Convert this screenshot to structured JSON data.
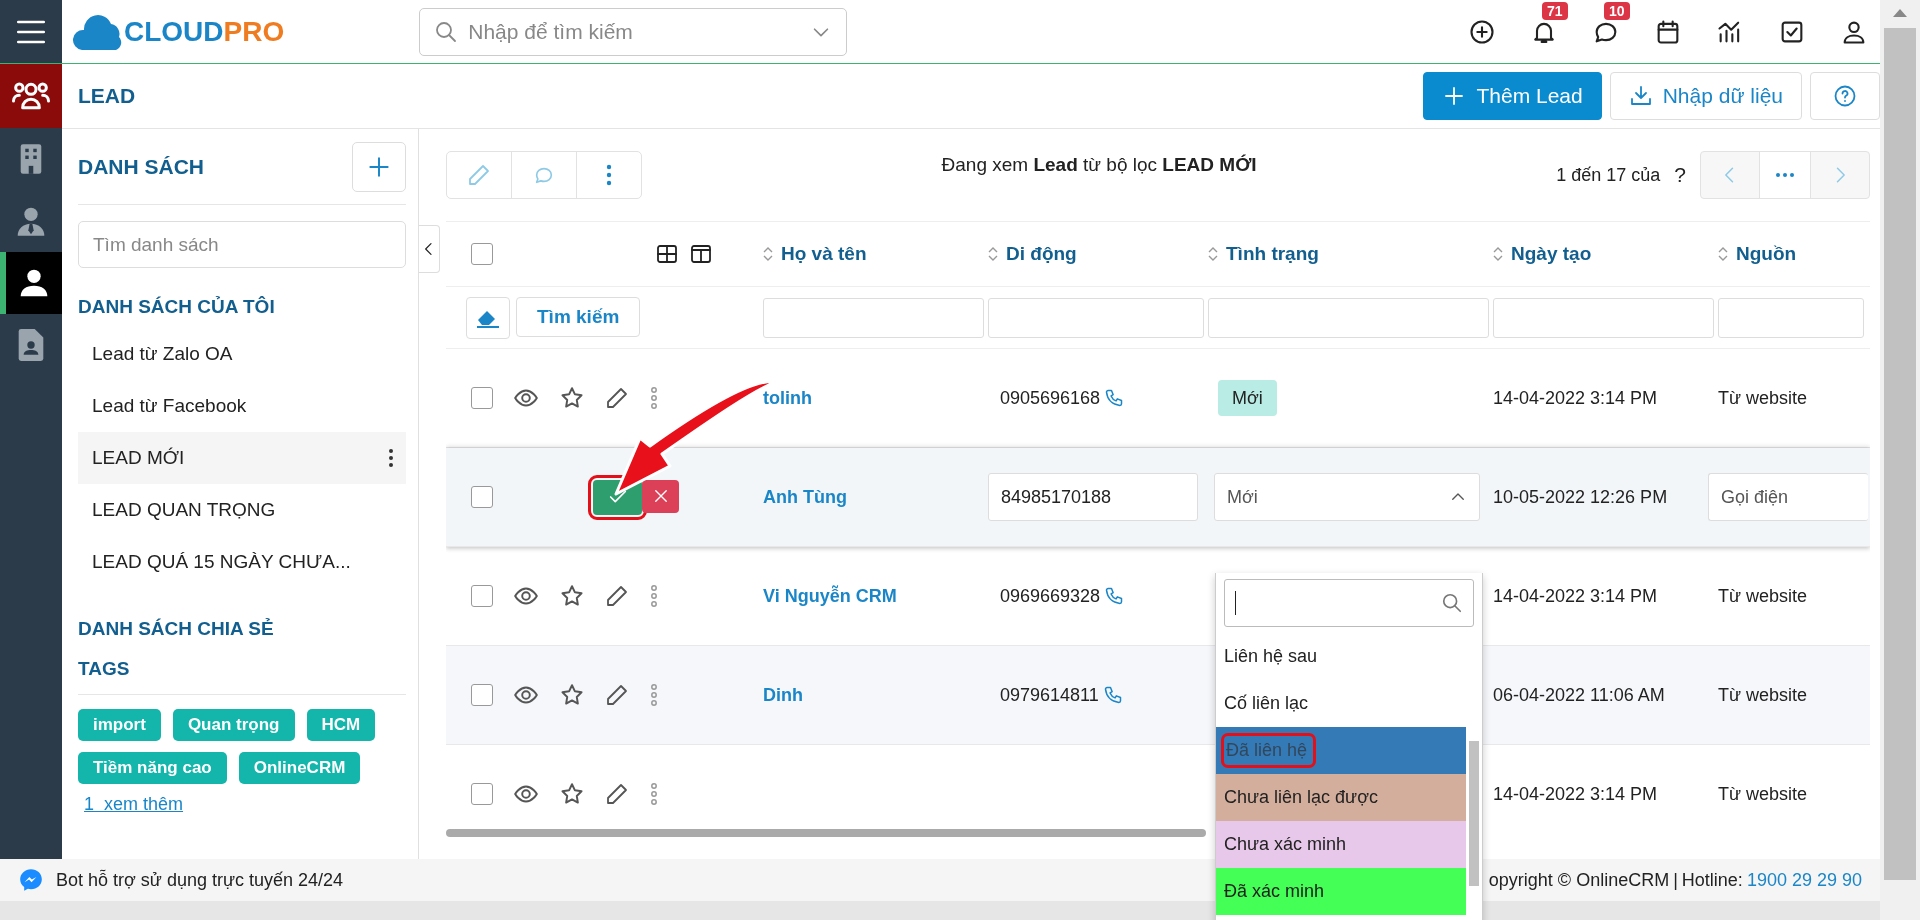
{
  "logo": {
    "part_1": "CLOUD",
    "part_2": "PRO"
  },
  "topbar": {
    "search_placeholder": "Nhập để tìm kiếm",
    "icons": [
      {
        "kind": "plus"
      },
      {
        "kind": "bell",
        "badge": "71"
      },
      {
        "kind": "chat",
        "badge": "10"
      },
      {
        "kind": "calendar"
      },
      {
        "kind": "chart"
      },
      {
        "kind": "task"
      },
      {
        "kind": "user"
      }
    ]
  },
  "rail": [
    {
      "kind": "group",
      "selected": false
    },
    {
      "kind": "building",
      "selected": false
    },
    {
      "kind": "agent",
      "selected": false
    },
    {
      "kind": "person",
      "selected": true
    },
    {
      "kind": "contact",
      "selected": false
    }
  ],
  "page_title": "LEAD",
  "header_buttons": [
    {
      "kind": "primary",
      "label": "Thêm Lead"
    },
    {
      "kind": "import",
      "label": "Nhập dữ liệu"
    },
    {
      "kind": "help"
    }
  ],
  "sidebar": {
    "title": "DANH SÁCH",
    "search_placeholder": "Tìm danh sách",
    "my_lists_title": "DANH SÁCH CỦA TÔI",
    "lists": [
      {
        "label": "Lead từ Zalo OA",
        "selected": false
      },
      {
        "label": "Lead từ Facebook",
        "selected": false
      },
      {
        "label": "LEAD MỚI",
        "selected": true
      },
      {
        "label": "LEAD QUAN TRỌNG",
        "selected": false
      },
      {
        "label": "LEAD QUÁ 15 NGÀY CHƯA...",
        "selected": false
      }
    ],
    "shared_title": "DANH SÁCH CHIA SẺ",
    "tags_title": "TAGS",
    "tags": [
      "import",
      "Quan trọng",
      "HCM",
      "Tiềm năng cao",
      "OnlineCRM"
    ],
    "more_link": "1  xem thêm"
  },
  "main": {
    "filter_text": "Đang xem **Lead** từ bộ lọc **LEAD MỚI**",
    "pagination": "1 đến 17 của",
    "pagination_help": "?",
    "select_all_checked": false,
    "columns": [
      "Họ và tên",
      "Di động",
      "Tình trạng",
      "Ngày tạo",
      "Nguồn"
    ],
    "search_button": "Tìm kiếm",
    "rows": [
      {
        "kind": "view",
        "checked": false,
        "name": "tolinh",
        "phone": "0905696168",
        "status": "Mới",
        "created": "14-04-2022 3:14 PM",
        "source": "Từ website"
      },
      {
        "kind": "edit",
        "checked": false,
        "name": "Anh Tùng",
        "phone": "84985170188",
        "status": "Mới",
        "status_expanded": true,
        "created": "10-05-2022 12:26 PM",
        "source": "Gọi điện",
        "confirm_highlighted": true
      },
      {
        "kind": "view",
        "checked": false,
        "name": "Vi Nguyễn CRM",
        "phone": "0969669328",
        "created": "14-04-2022 3:14 PM",
        "source": "Từ website"
      },
      {
        "kind": "view",
        "checked": false,
        "name": "Dinh",
        "phone": "0979614811",
        "created": "06-04-2022 11:06 AM",
        "source": "Từ website"
      },
      {
        "kind": "view",
        "checked": false,
        "created": "14-04-2022 3:14 PM",
        "source": "Từ website"
      }
    ],
    "status_options": [
      {
        "label": "Liên hệ sau",
        "color": "#ffffff",
        "selected": false,
        "highlighted": false
      },
      {
        "label": "Cố liên lạc",
        "color": "#ffffff",
        "selected": false,
        "highlighted": false
      },
      {
        "label": "Đã liên hệ",
        "color": "#337ab7",
        "selected": true,
        "highlighted": true
      },
      {
        "label": "Chưa liên lạc được",
        "color": "#d4ae9c",
        "selected": false,
        "highlighted": false
      },
      {
        "label": "Chưa xác minh",
        "color": "#e8c8ea",
        "selected": false,
        "highlighted": false
      },
      {
        "label": "Đã xác minh",
        "color": "#44ff55",
        "selected": false,
        "highlighted": false
      }
    ]
  },
  "footer": {
    "bot_text": "Bot hỗ trợ sử dụng trực tuyến 24/24",
    "copyright": "opyright © OnlineCRM",
    "separator": "|",
    "hotline_label": "Hotline:",
    "hotline": "1900 29 29 90"
  }
}
